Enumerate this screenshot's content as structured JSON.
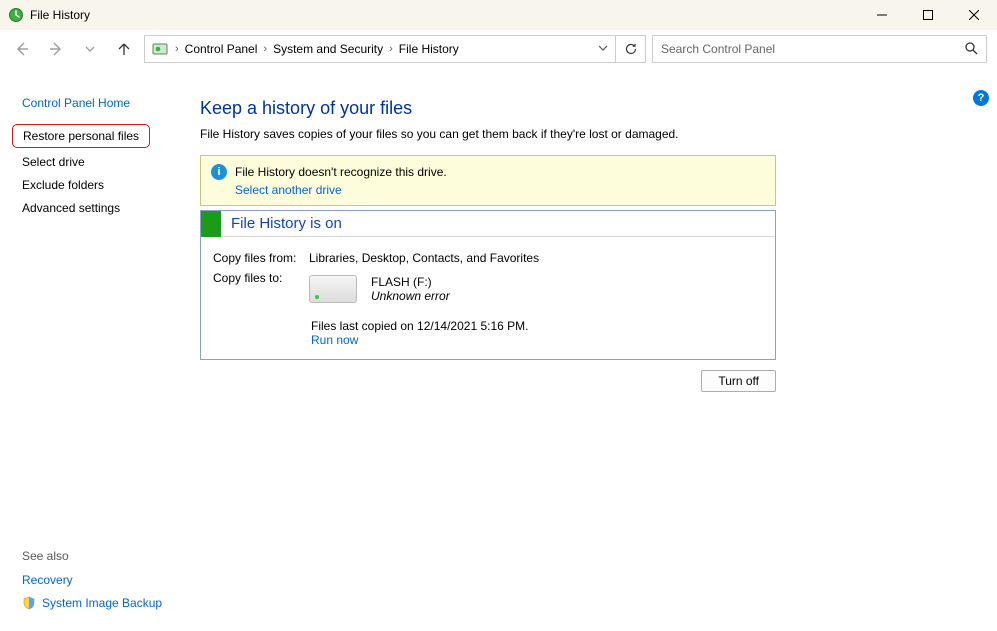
{
  "window": {
    "title": "File History"
  },
  "nav": {
    "breadcrumbs": [
      "Control Panel",
      "System and Security",
      "File History"
    ]
  },
  "search": {
    "placeholder": "Search Control Panel"
  },
  "sidebar": {
    "home": "Control Panel Home",
    "links": [
      "Restore personal files",
      "Select drive",
      "Exclude folders",
      "Advanced settings"
    ],
    "see_also_label": "See also",
    "see_also": [
      "Recovery",
      "System Image Backup"
    ]
  },
  "main": {
    "heading": "Keep a history of your files",
    "subtext": "File History saves copies of your files so you can get them back if they're lost or damaged.",
    "warning": {
      "msg": "File History doesn't recognize this drive.",
      "link": "Select another drive"
    },
    "status_title": "File History is on",
    "copy_from_label": "Copy files from:",
    "copy_from_value": "Libraries, Desktop, Contacts, and Favorites",
    "copy_to_label": "Copy files to:",
    "drive_name": "FLASH (F:)",
    "drive_error": "Unknown error",
    "last_copied": "Files last copied on 12/14/2021 5:16 PM.",
    "run_now": "Run now",
    "turn_off": "Turn off"
  }
}
